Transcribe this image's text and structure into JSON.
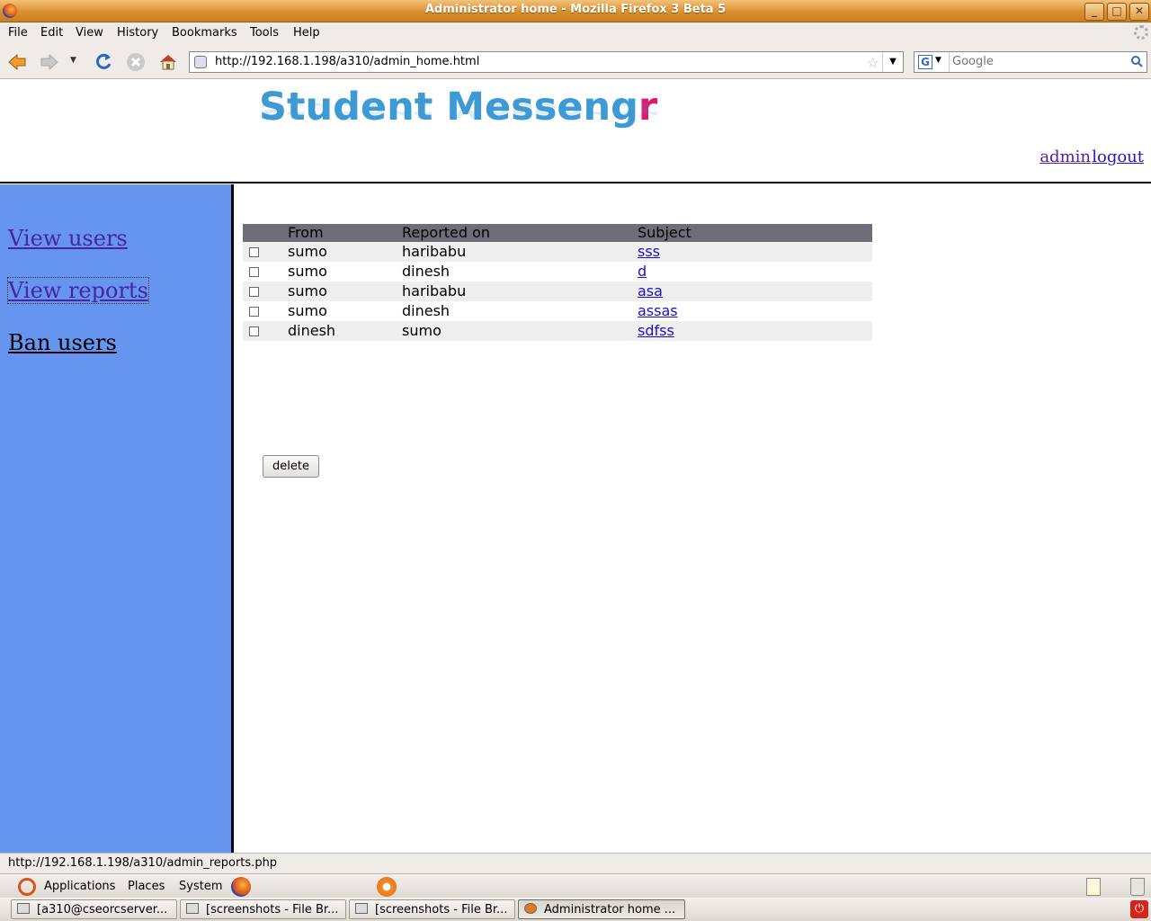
{
  "window": {
    "title": "Administrator home - Mozilla Firefox 3 Beta 5",
    "minimize": "_",
    "maximize": "□",
    "close": "✕"
  },
  "menubar": {
    "items": [
      "File",
      "Edit",
      "View",
      "History",
      "Bookmarks",
      "Tools",
      "Help"
    ]
  },
  "navbar": {
    "url": "http://192.168.1.198/a310/admin_home.html",
    "search_engine": "G",
    "search_placeholder": "Google"
  },
  "site": {
    "logo_main": "Student Messeng",
    "logo_last": "r",
    "user_link": "admin",
    "logout_link": "logout",
    "nav": {
      "view_users": "View users",
      "view_reports": "View reports",
      "ban_users": "Ban users"
    }
  },
  "reports": {
    "headers": [
      "",
      "From",
      "Reported on",
      "Subject"
    ],
    "rows": [
      {
        "from": "sumo",
        "reported_on": "haribabu",
        "subject": "sss"
      },
      {
        "from": "sumo",
        "reported_on": "dinesh",
        "subject": "d"
      },
      {
        "from": "sumo",
        "reported_on": "haribabu",
        "subject": "asa"
      },
      {
        "from": "sumo",
        "reported_on": "dinesh",
        "subject": "assas"
      },
      {
        "from": "dinesh",
        "reported_on": "sumo",
        "subject": "sdfss"
      }
    ],
    "delete_label": "delete"
  },
  "statusbar": {
    "text": "http://192.168.1.198/a310/admin_reports.php"
  },
  "panel": {
    "applications": "Applications",
    "places": "Places",
    "system": "System"
  },
  "taskbar": {
    "tasks": [
      {
        "label": "[a310@cseorcserver..."
      },
      {
        "label": "[screenshots - File Br..."
      },
      {
        "label": "[screenshots - File Br..."
      },
      {
        "label": "Administrator home ..."
      }
    ]
  },
  "colors": {
    "sidebar": "#6595ef",
    "table_header": "#6f6e78",
    "logo_blue": "#3d9ad4",
    "logo_accent": "#e5166d"
  }
}
